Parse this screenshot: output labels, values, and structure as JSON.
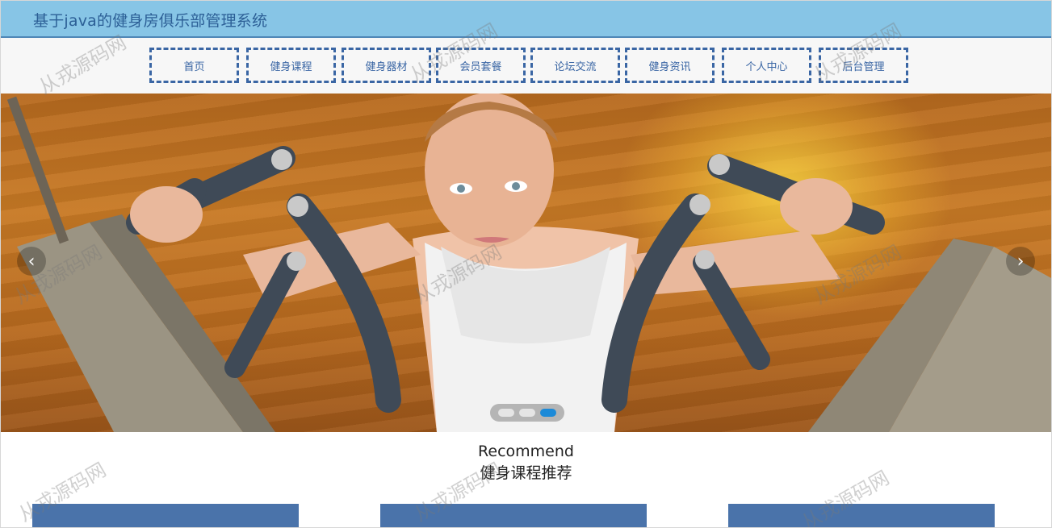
{
  "header": {
    "title": "基于java的健身房俱乐部管理系统"
  },
  "nav": {
    "items": [
      {
        "label": "首页"
      },
      {
        "label": "健身课程"
      },
      {
        "label": "健身器材"
      },
      {
        "label": "会员套餐"
      },
      {
        "label": "论坛交流"
      },
      {
        "label": "健身资讯"
      },
      {
        "label": "个人中心"
      },
      {
        "label": "后台管理"
      }
    ]
  },
  "banner": {
    "prev_icon": "chevron-left-icon",
    "next_icon": "chevron-right-icon",
    "prev_glyph": "‹",
    "next_glyph": "›",
    "slides": 3,
    "active_slide": 3,
    "image": "woman using chest press machine in gym"
  },
  "recommend": {
    "title_en": "Recommend",
    "title_cn": "健身课程推荐"
  },
  "watermark": {
    "text": "从戎源码网"
  },
  "colors": {
    "header_bg": "#87c5e6",
    "title": "#2c5f96",
    "nav_border": "#3a66a4",
    "card": "#4a73aa",
    "dot_active": "#1c8ad8"
  }
}
